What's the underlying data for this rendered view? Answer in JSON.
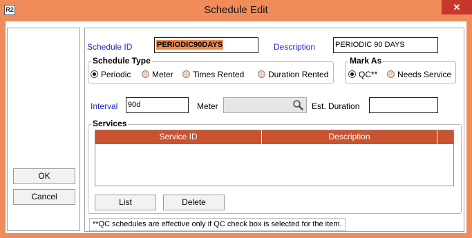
{
  "window": {
    "title": "Schedule Edit",
    "app_icon_text": "R2",
    "close_symbol": "✕"
  },
  "left_panel": {
    "ok_label": "OK",
    "cancel_label": "Cancel"
  },
  "form": {
    "schedule_id_label": "Schedule ID",
    "schedule_id_value": "PERIODIC90DAYS",
    "description_label": "Description",
    "description_value": "PERIODIC 90 DAYS",
    "schedule_type": {
      "title": "Schedule Type",
      "options": [
        "Periodic",
        "Meter",
        "Times Rented",
        "Duration Rented"
      ],
      "selected": "Periodic"
    },
    "mark_as": {
      "title": "Mark As",
      "options": [
        "QC**",
        "Needs Service"
      ],
      "selected": "QC**"
    },
    "interval_label": "Interval",
    "interval_value": "90d",
    "meter_label": "Meter",
    "meter_value": "",
    "est_duration_label": "Est.  Duration",
    "est_duration_value": ""
  },
  "services": {
    "title": "Services",
    "columns": [
      "Service ID",
      "Description"
    ],
    "rows": [],
    "list_label": "List",
    "delete_label": "Delete"
  },
  "footer_note": "**QC schedules are effective only if QC check box is selected for the item.",
  "colors": {
    "window_frame": "#f08c5a",
    "close_button": "#c7362b",
    "table_header": "#c9532f",
    "highlight": "#ef8a4a",
    "label_blue": "#1a28c8"
  },
  "icons": {
    "app": "app-icon",
    "close": "close-icon",
    "meter_lookup": "magnifier-icon"
  }
}
